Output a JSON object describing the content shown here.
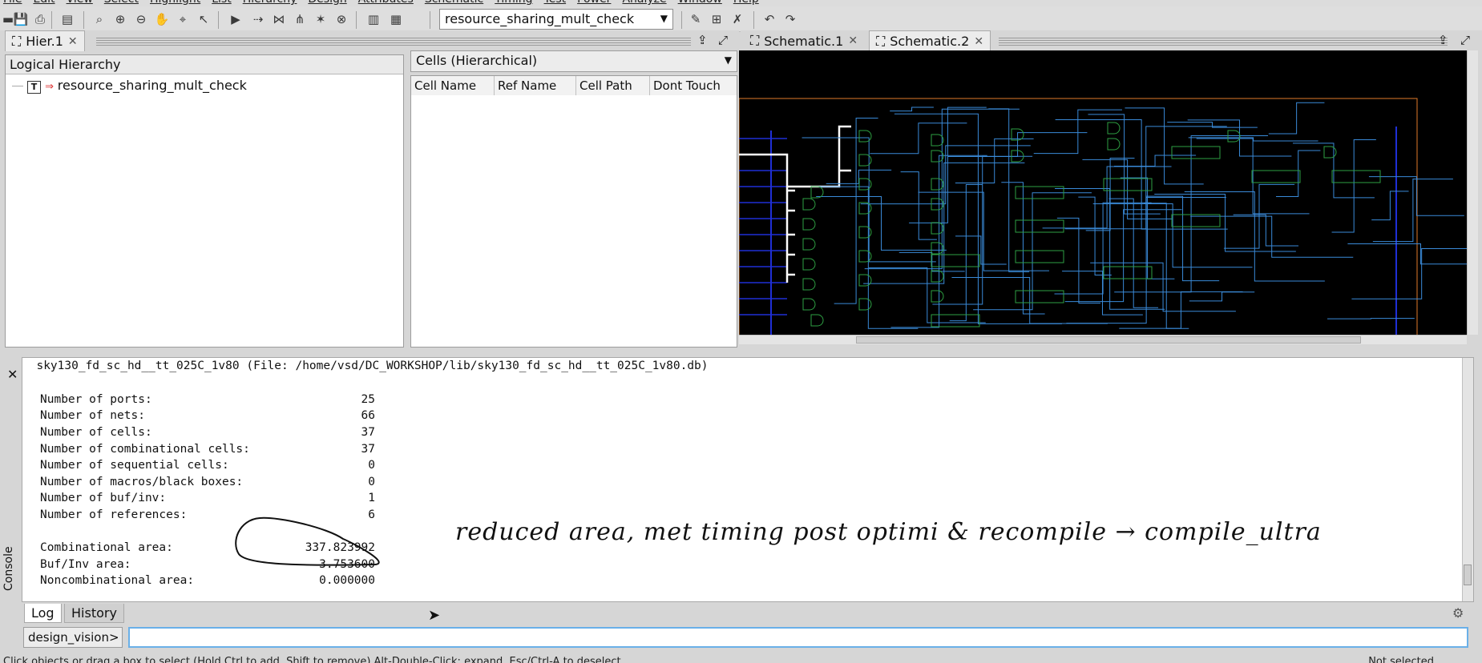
{
  "menubar": {
    "items": [
      "File",
      "Edit",
      "View",
      "Select",
      "Highlight",
      "List",
      "Hierarchy",
      "Design",
      "Attributes",
      "Schematic",
      "Timing",
      "Test",
      "Power",
      "Analyze",
      "Window",
      "Help"
    ]
  },
  "toolbar": {
    "design_select_value": "resource_sharing_mult_check"
  },
  "hier_tabs": [
    {
      "label": "Hier.1"
    }
  ],
  "schematic_tabs": [
    {
      "label": "Schematic.1"
    },
    {
      "label": "Schematic.2"
    }
  ],
  "logical_hierarchy": {
    "title": "Logical Hierarchy",
    "root_badge": "T",
    "root_item": "resource_sharing_mult_check"
  },
  "cells_panel": {
    "dropdown_value": "Cells (Hierarchical)",
    "columns": [
      "Cell Name",
      "Ref Name",
      "Cell Path",
      "Dont Touch"
    ]
  },
  "console": {
    "header_line": "  sky130_fd_sc_hd__tt_025C_1v80 (File: /home/vsd/DC_WORKSHOP/lib/sky130_fd_sc_hd__tt_025C_1v80.db)",
    "rows": [
      {
        "label": "Number of ports:",
        "value": "25"
      },
      {
        "label": "Number of nets:",
        "value": "66"
      },
      {
        "label": "Number of cells:",
        "value": "37"
      },
      {
        "label": "Number of combinational cells:",
        "value": "37"
      },
      {
        "label": "Number of sequential cells:",
        "value": "0"
      },
      {
        "label": "Number of macros/black boxes:",
        "value": "0"
      },
      {
        "label": "Number of buf/inv:",
        "value": "1"
      },
      {
        "label": "Number of references:",
        "value": "6"
      }
    ],
    "area_rows": [
      {
        "label": "Combinational area:",
        "value": "337.823992"
      },
      {
        "label": "Buf/Inv area:",
        "value": "3.753600"
      },
      {
        "label": "Noncombinational area:",
        "value": "0.000000"
      }
    ],
    "side_label": "Console",
    "tabs": [
      "Log",
      "History"
    ],
    "prompt": "design_vision>",
    "input_value": ""
  },
  "annotation": {
    "handwritten_text": "reduced area, met timing post optimi & recompile → compile_ultra"
  },
  "statusbar": {
    "left_text": "Click objects or drag a box to select (Hold Ctrl to add, Shift to remove) Alt-Double-Click: expand, Esc/Ctrl-A to deselect",
    "right_text": "Not selected"
  },
  "colors": {
    "schematic_bg": "#000000",
    "gate": "#2ea043",
    "wire": "#3a8ad8",
    "bus": "#1f2fd6",
    "border": "#e07a2a",
    "input_focus": "#6ab0e8"
  }
}
